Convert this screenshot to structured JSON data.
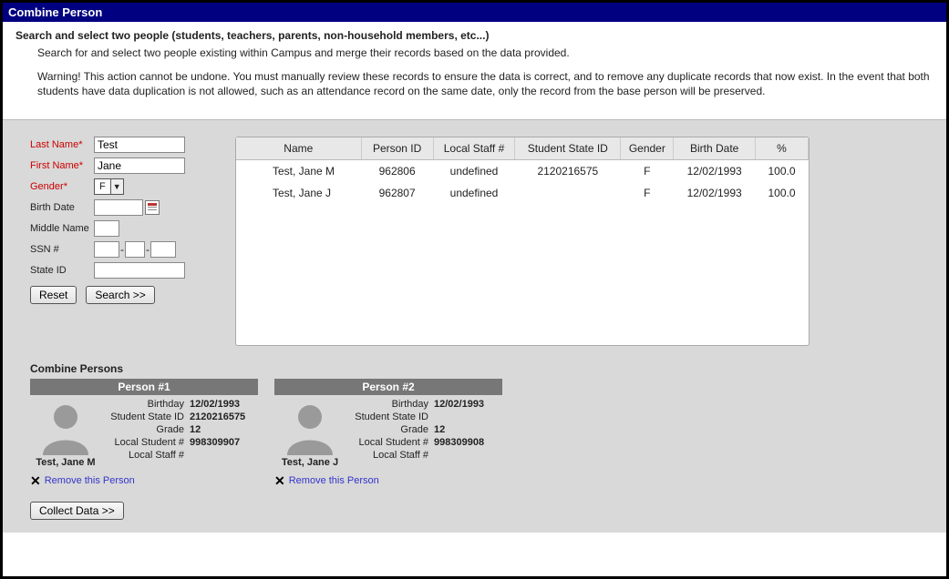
{
  "titlebar": "Combine Person",
  "intro": {
    "heading": "Search and select two people (students, teachers, parents, non-household members, etc...)",
    "p1": "Search for and select two people existing within Campus and merge their records based on the data provided.",
    "p2": "Warning! This action cannot be undone. You must manually review these records to ensure the data is correct, and to remove any duplicate records that now exist. In the event that both students have data duplication is not allowed, such as an attendance record on the same date, only the record from the base person will be preserved."
  },
  "form": {
    "lastname_label": "Last Name*",
    "lastname_value": "Test",
    "firstname_label": "First Name*",
    "firstname_value": "Jane",
    "gender_label": "Gender*",
    "gender_value": "F",
    "birthdate_label": "Birth Date",
    "birthdate_value": "",
    "middlename_label": "Middle Name",
    "middlename_value": "",
    "ssn_label": "SSN #",
    "stateid_label": "State ID",
    "stateid_value": "",
    "reset_btn": "Reset",
    "search_btn": "Search >>"
  },
  "results": {
    "headers": {
      "name": "Name",
      "personid": "Person ID",
      "localstaff": "Local Staff #",
      "studentstateid": "Student State ID",
      "gender": "Gender",
      "birthdate": "Birth Date",
      "pct": "%"
    },
    "rows": [
      {
        "name": "Test, Jane M",
        "personid": "962806",
        "localstaff": "undefined",
        "studentstateid": "2120216575",
        "gender": "F",
        "birthdate": "12/02/1993",
        "pct": "100.0"
      },
      {
        "name": "Test, Jane J",
        "personid": "962807",
        "localstaff": "undefined",
        "studentstateid": "",
        "gender": "F",
        "birthdate": "12/02/1993",
        "pct": "100.0"
      }
    ]
  },
  "combine": {
    "heading": "Combine Persons",
    "card_labels": {
      "birthday": "Birthday",
      "studentstateid": "Student State ID",
      "grade": "Grade",
      "localstudent": "Local Student #",
      "localstaff": "Local Staff #"
    },
    "cards": [
      {
        "title": "Person #1",
        "name": "Test, Jane M",
        "birthday": "12/02/1993",
        "studentstateid": "2120216575",
        "grade": "12",
        "localstudent": "998309907",
        "localstaff": ""
      },
      {
        "title": "Person #2",
        "name": "Test, Jane J",
        "birthday": "12/02/1993",
        "studentstateid": "",
        "grade": "12",
        "localstudent": "998309908",
        "localstaff": ""
      }
    ],
    "remove_label": "Remove this Person",
    "collect_btn": "Collect Data >>"
  }
}
